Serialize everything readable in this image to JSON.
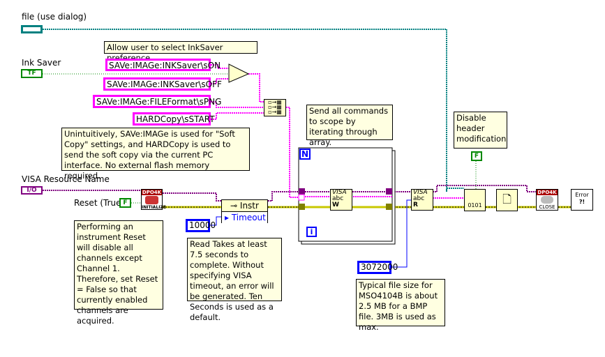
{
  "controls": {
    "file": {
      "label": "file (use dialog)",
      "icon": "path-icon"
    },
    "ink_saver": {
      "label": "Ink Saver",
      "glyph": "TF"
    },
    "visa": {
      "label": "VISA Resource Name",
      "glyph": "I/O"
    },
    "reset": {
      "label": "Reset (True)",
      "value": "F"
    }
  },
  "constants": {
    "ink_on": "SAVe:IMAGe:INKSaver\\sON",
    "ink_off": "SAVe:IMAGe:INKSaver\\sOFF",
    "file_format": "SAVe:IMAGe:FILEFormat\\sPNG",
    "hardcopy": "HARDCopy\\sSTART",
    "timeout_value": "10000",
    "read_count": "3072000",
    "header_flag": "F"
  },
  "comments": {
    "inksaver": "Allow user to select InkSaver preference.",
    "soft_copy": "Unintuitively, SAVe:IMAGe is used for \"Soft Copy\" settings, and HARDCopy is used to send the soft copy via the current PC interface. No external flash memory required.",
    "reset": "Performing an instrument Reset will disable all channels except Channel 1. Therefore, set Reset = False so that currently enabled channels are acquired.",
    "timeout": "Read Takes at least 7.5 seconds to complete. Without specifying VISA timeout, an error will be generated. Ten Seconds is used as a default.",
    "send_all": "Send all commands to scope by iterating through array.",
    "header": "Disable header modification",
    "file_size": "Typical file size for MSO4104B is about 2.5 MB for a BMP file. 3MB is used as max."
  },
  "nodes": {
    "initialize": {
      "header": "DPO4K",
      "footer": "INITIALIZE"
    },
    "property": {
      "class": "Instr",
      "property": "Timeout"
    },
    "loop": {
      "count": "N",
      "index": "i"
    },
    "visa_write": {
      "top": "VISA",
      "mid": "abc",
      "mode": "W"
    },
    "visa_read": {
      "top": "VISA",
      "mid": "abc",
      "mode": "R"
    },
    "write_file": {
      "text": "0101"
    },
    "close": {
      "header": "DPO4K",
      "footer": "CLOSE"
    },
    "error": {
      "text": "Error",
      "sub": "?!"
    }
  },
  "colors": {
    "string": "#ff00ff",
    "visa": "#800080",
    "error": "#c8c800",
    "path": "#008080",
    "boolean": "#008000",
    "numeric": "#0000ff",
    "comment": "#ffffe1"
  }
}
